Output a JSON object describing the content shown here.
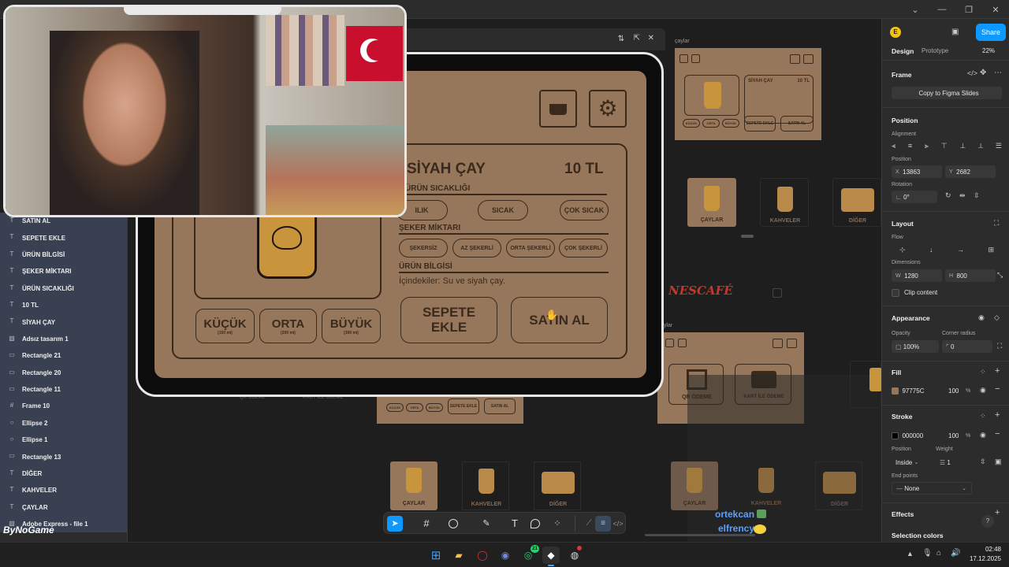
{
  "window": {
    "minimize": "—",
    "restore": "❐",
    "close": "✕",
    "collapse": "⌄"
  },
  "canvas": {
    "frame_labels": {
      "caylar_top": "çaylar",
      "caylar_mid": "aylar"
    },
    "main_frame": {
      "title": "SİYAH ÇAY",
      "price": "10 TL",
      "temp_heading": "ÜRÜN SICAKLIĞI",
      "temps": [
        "ILIK",
        "SICAK",
        "ÇOK SICAK"
      ],
      "sugar_heading": "ŞEKER MİKTARI",
      "sugars": [
        "ŞEKERSİZ",
        "AZ ŞEKERLİ",
        "ORTA ŞEKERLİ",
        "ÇOK ŞEKERLİ"
      ],
      "info_heading": "ÜRÜN BİLGİSİ",
      "info_text": "İçindekiler: Su ve siyah çay.",
      "sizes": [
        {
          "label": "KÜÇÜK",
          "ml": "(150 ml)"
        },
        {
          "label": "ORTA",
          "ml": "(200 ml)"
        },
        {
          "label": "BÜYÜK",
          "ml": "(300 ml)"
        }
      ],
      "add_to_cart": "SEPETE EKLE",
      "buy": "SATIN AL"
    },
    "mini_frame": {
      "title": "SİYAH ÇAY",
      "price": "10 TL",
      "sizes": [
        "KÜÇÜK",
        "ORTA",
        "BÜYÜK"
      ],
      "add_to_cart": "SEPETE EKLE",
      "buy": "SATIN AL"
    },
    "categories": [
      "ÇAYLAR",
      "KAHVELER",
      "DİĞER"
    ],
    "nescafe": "NESCAFÉ",
    "payment": {
      "qr": "QR ÖDEME",
      "card": "KART İLE ÖDEME"
    }
  },
  "layers": [
    {
      "label": "SATIN AL",
      "icon": "T"
    },
    {
      "label": "SEPETE EKLE",
      "icon": "T"
    },
    {
      "label": "ÜRÜN BİLGİSİ",
      "icon": "T"
    },
    {
      "label": "ŞEKER MİKTARI",
      "icon": "T"
    },
    {
      "label": "ÜRÜN SICAKLIĞI",
      "icon": "T"
    },
    {
      "label": "10 TL",
      "icon": "T"
    },
    {
      "label": "SİYAH ÇAY",
      "icon": "T"
    },
    {
      "label": "Adsız tasarım 1",
      "icon": "▧"
    },
    {
      "label": "Rectangle 21",
      "icon": "▭"
    },
    {
      "label": "Rectangle 20",
      "icon": "▭"
    },
    {
      "label": "Rectangle 11",
      "icon": "▭"
    },
    {
      "label": "Frame 10",
      "icon": "#"
    },
    {
      "label": "Ellipse 2",
      "icon": "○"
    },
    {
      "label": "Ellipse 1",
      "icon": "○"
    },
    {
      "label": "Rectangle 13",
      "icon": "▭"
    },
    {
      "label": "DİĞER",
      "icon": "T"
    },
    {
      "label": "KAHVELER",
      "icon": "T"
    },
    {
      "label": "ÇAYLAR",
      "icon": "T"
    },
    {
      "label": "Adobe Express - file 1",
      "icon": "▧"
    }
  ],
  "brand": "ByNoGame",
  "right_panel": {
    "avatar": "E",
    "share": "Share",
    "tabs": {
      "design": "Design",
      "prototype": "Prototype"
    },
    "zoom": "22%",
    "frame_label": "Frame",
    "copy_slides": "Copy to Figma Slides",
    "position_heading": "Position",
    "alignment": "Alignment",
    "position_label": "Position",
    "x_label": "X",
    "x_value": "13863",
    "y_label": "Y",
    "y_value": "2682",
    "rotation_label": "Rotation",
    "rotation_value": "0°",
    "layout_heading": "Layout",
    "flow_label": "Flow",
    "dimensions_label": "Dimensions",
    "w_label": "W",
    "w_value": "1280",
    "h_label": "H",
    "h_value": "800",
    "clip_content": "Clip content",
    "appearance_heading": "Appearance",
    "opacity_label": "Opacity",
    "opacity_value": "100%",
    "corner_label": "Corner radius",
    "corner_value": "0",
    "fill_heading": "Fill",
    "fill_hex": "97775C",
    "fill_opacity": "100",
    "pct": "%",
    "fill_color": "#97775c",
    "stroke_heading": "Stroke",
    "stroke_hex": "000000",
    "stroke_opacity": "100",
    "stroke_position_label": "Position",
    "stroke_position": "Inside",
    "weight_label": "Weight",
    "weight_value": "1",
    "end_points_label": "End points",
    "end_points": "None",
    "effects_heading": "Effects",
    "selection_colors": "Selection colors",
    "help": "?"
  },
  "chat": [
    {
      "user": "ortekcan"
    },
    {
      "user": "elfrency"
    }
  ],
  "taskbar": {
    "time": "02:48",
    "date": "17.12.2025",
    "whatsapp_badge": "21"
  }
}
